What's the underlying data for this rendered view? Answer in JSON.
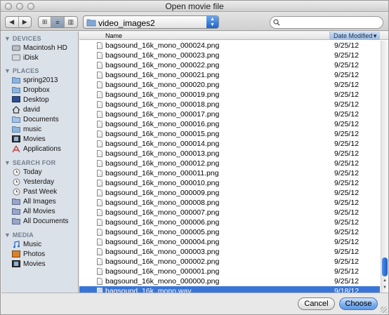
{
  "window": {
    "title": "Open movie file"
  },
  "toolbar": {
    "nav_back": "◀",
    "nav_forward": "▶",
    "view_icon": "⊞",
    "view_list": "≡",
    "view_columns": "▥",
    "location": "video_images2",
    "search_placeholder": "",
    "search_value": ""
  },
  "sidebar": {
    "devices": {
      "title": "DEVICES",
      "items": [
        {
          "label": "Macintosh HD",
          "icon": "hard-drive-icon"
        },
        {
          "label": "iDisk",
          "icon": "idisk-icon"
        }
      ]
    },
    "places": {
      "title": "PLACES",
      "items": [
        {
          "label": "spring2013",
          "icon": "folder-icon"
        },
        {
          "label": "Dropbox",
          "icon": "dropbox-folder-icon"
        },
        {
          "label": "Desktop",
          "icon": "desktop-icon"
        },
        {
          "label": "david",
          "icon": "home-icon"
        },
        {
          "label": "Documents",
          "icon": "documents-icon"
        },
        {
          "label": "music",
          "icon": "folder-icon"
        },
        {
          "label": "Movies",
          "icon": "movies-icon"
        },
        {
          "label": "Applications",
          "icon": "applications-icon"
        }
      ]
    },
    "search_for": {
      "title": "SEARCH FOR",
      "items": [
        {
          "label": "Today",
          "icon": "clock-icon"
        },
        {
          "label": "Yesterday",
          "icon": "clock-icon"
        },
        {
          "label": "Past Week",
          "icon": "clock-icon"
        },
        {
          "label": "All Images",
          "icon": "smart-folder-icon"
        },
        {
          "label": "All Movies",
          "icon": "smart-folder-icon"
        },
        {
          "label": "All Documents",
          "icon": "smart-folder-icon"
        }
      ]
    },
    "media": {
      "title": "MEDIA",
      "items": [
        {
          "label": "Music",
          "icon": "music-icon"
        },
        {
          "label": "Photos",
          "icon": "photos-icon"
        },
        {
          "label": "Movies",
          "icon": "movies-icon"
        }
      ]
    }
  },
  "list": {
    "columns": {
      "name": "Name",
      "date": "Date Modified",
      "sort_indicator": "▼"
    },
    "files": [
      {
        "name": "bagsound_16k_mono_000024.png",
        "date": "9/25/12"
      },
      {
        "name": "bagsound_16k_mono_000023.png",
        "date": "9/25/12"
      },
      {
        "name": "bagsound_16k_mono_000022.png",
        "date": "9/25/12"
      },
      {
        "name": "bagsound_16k_mono_000021.png",
        "date": "9/25/12"
      },
      {
        "name": "bagsound_16k_mono_000020.png",
        "date": "9/25/12"
      },
      {
        "name": "bagsound_16k_mono_000019.png",
        "date": "9/25/12"
      },
      {
        "name": "bagsound_16k_mono_000018.png",
        "date": "9/25/12"
      },
      {
        "name": "bagsound_16k_mono_000017.png",
        "date": "9/25/12"
      },
      {
        "name": "bagsound_16k_mono_000016.png",
        "date": "9/25/12"
      },
      {
        "name": "bagsound_16k_mono_000015.png",
        "date": "9/25/12"
      },
      {
        "name": "bagsound_16k_mono_000014.png",
        "date": "9/25/12"
      },
      {
        "name": "bagsound_16k_mono_000013.png",
        "date": "9/25/12"
      },
      {
        "name": "bagsound_16k_mono_000012.png",
        "date": "9/25/12"
      },
      {
        "name": "bagsound_16k_mono_000011.png",
        "date": "9/25/12"
      },
      {
        "name": "bagsound_16k_mono_000010.png",
        "date": "9/25/12"
      },
      {
        "name": "bagsound_16k_mono_000009.png",
        "date": "9/25/12"
      },
      {
        "name": "bagsound_16k_mono_000008.png",
        "date": "9/25/12"
      },
      {
        "name": "bagsound_16k_mono_000007.png",
        "date": "9/25/12"
      },
      {
        "name": "bagsound_16k_mono_000006.png",
        "date": "9/25/12"
      },
      {
        "name": "bagsound_16k_mono_000005.png",
        "date": "9/25/12"
      },
      {
        "name": "bagsound_16k_mono_000004.png",
        "date": "9/25/12"
      },
      {
        "name": "bagsound_16k_mono_000003.png",
        "date": "9/25/12"
      },
      {
        "name": "bagsound_16k_mono_000002.png",
        "date": "9/25/12"
      },
      {
        "name": "bagsound_16k_mono_000001.png",
        "date": "9/25/12"
      },
      {
        "name": "bagsound_16k_mono_000000.png",
        "date": "9/25/12"
      },
      {
        "name": "bagsound_16k_mono.wav",
        "date": "9/18/12",
        "selected": true
      }
    ]
  },
  "buttons": {
    "cancel": "Cancel",
    "choose": "Choose"
  },
  "colors": {
    "selection": "#3875d7",
    "sidebar_bg": "#dbe1e9",
    "default_button": "#7fb0ee"
  }
}
